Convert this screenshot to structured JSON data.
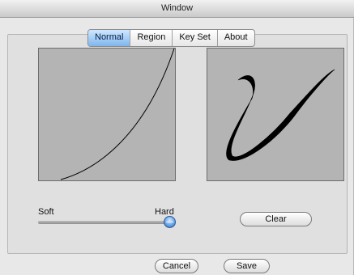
{
  "window": {
    "title": "Window"
  },
  "tabs": [
    {
      "label": "Normal",
      "active": true
    },
    {
      "label": "Region",
      "active": false
    },
    {
      "label": "Key Set",
      "active": false
    },
    {
      "label": "About",
      "active": false
    }
  ],
  "pressure_slider": {
    "min_label": "Soft",
    "max_label": "Hard",
    "value": 1.0
  },
  "buttons": {
    "clear": "Clear",
    "cancel": "Cancel",
    "save": "Save"
  },
  "colors": {
    "panel_bg": "#b4b4b4",
    "active_tab": "#7fb6ee",
    "stroke": "#000000"
  }
}
